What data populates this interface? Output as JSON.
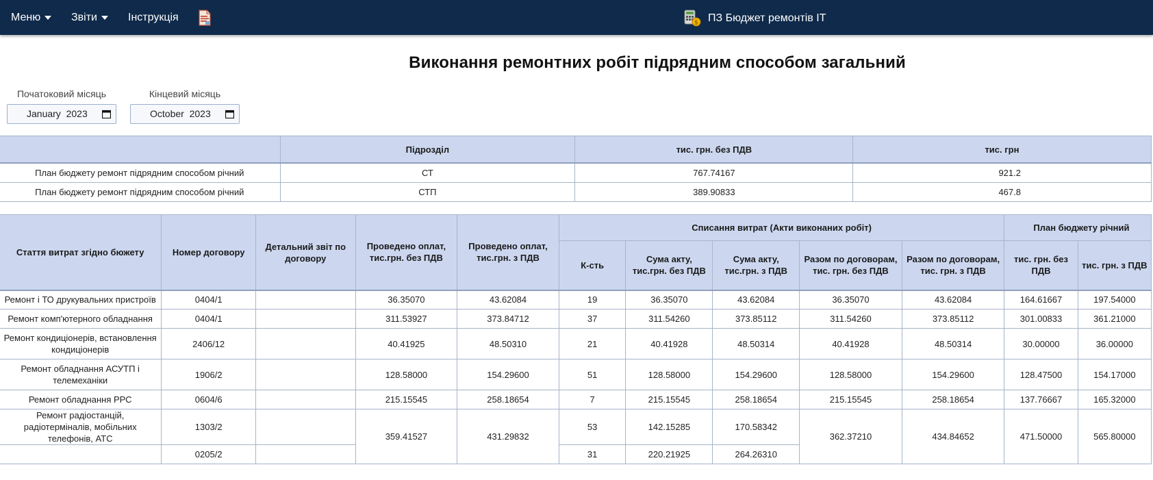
{
  "nav": {
    "menu_label": "Меню",
    "reports_label": "Звіти",
    "instructions_label": "Інструкція",
    "pdf_icon": "pdf-document-icon",
    "app_icon": "calculator-budget-icon",
    "app_title": "ПЗ Бюджет ремонтів ІТ",
    "colors": {
      "navbar_bg": "#0f2a4a",
      "header_bg": "#ccd7ef"
    }
  },
  "page_title": "Виконання ремонтних робіт підрядним способом загальний",
  "filters": {
    "start_label": "Початоковий місяць",
    "start_value": "January  2023",
    "end_label": "Кінцевий місяць",
    "end_value": "October  2023"
  },
  "summary_table": {
    "headers": [
      "",
      "Підрозділ",
      "тис. грн. без ПДВ",
      "тис. грн"
    ],
    "rows": [
      [
        "План бюджету ремонт підрядним способом річний",
        "СТ",
        "767.74167",
        "921.2"
      ],
      [
        "План бюджету ремонт підрядним способом річний",
        "СТП",
        "389.90833",
        "467.8"
      ]
    ]
  },
  "main_table": {
    "headers": {
      "article": "Стаття витрат згідно бюжету",
      "contract_no": "Номер договору",
      "detail_report": "Детальний звіт по договору",
      "paid_no_vat": "Проведено оплат, тис.грн. без ПДВ",
      "paid_vat": "Проведено оплат, тис.грн. з ПДВ",
      "writeoff_group": "Списання витрат (Акти виконаних робіт)",
      "count": "К-сть",
      "act_no_vat": "Сума акту, тис.грн. без ПДВ",
      "act_vat": "Сума акту, тис.грн. з ПДВ",
      "total_no_vat": "Разом по договорам, тис. грн. без ПДВ",
      "total_vat": "Разом по договорам, тис. грн. з ПДВ",
      "plan_group": "План бюджету річний",
      "plan_no_vat": "тис. грн. без ПДВ",
      "plan_vat": "тис. грн. з ПДВ"
    },
    "rows": [
      {
        "article": "Ремонт і ТО друкувальних пристроїв",
        "contract": "0404/1",
        "detail": "",
        "paid_no_vat": "36.35070",
        "paid_vat": "43.62084",
        "count": "19",
        "act_no_vat": "36.35070",
        "act_vat": "43.62084",
        "total_no_vat": "36.35070",
        "total_vat": "43.62084",
        "plan_no_vat": "164.61667",
        "plan_vat": "197.54000"
      },
      {
        "article": "Ремонт комп'ютерного обладнання",
        "contract": "0404/1",
        "detail": "",
        "paid_no_vat": "311.53927",
        "paid_vat": "373.84712",
        "count": "37",
        "act_no_vat": "311.54260",
        "act_vat": "373.85112",
        "total_no_vat": "311.54260",
        "total_vat": "373.85112",
        "plan_no_vat": "301.00833",
        "plan_vat": "361.21000"
      },
      {
        "article": "Ремонт кондиціонерів, встановлення кондиціонерів",
        "contract": "2406/12",
        "detail": "",
        "paid_no_vat": "40.41925",
        "paid_vat": "48.50310",
        "count": "21",
        "act_no_vat": "40.41928",
        "act_vat": "48.50314",
        "total_no_vat": "40.41928",
        "total_vat": "48.50314",
        "plan_no_vat": "30.00000",
        "plan_vat": "36.00000"
      },
      {
        "article": "Ремонт обладнання АСУТП і телемеханіки",
        "contract": "1906/2",
        "detail": "",
        "paid_no_vat": "128.58000",
        "paid_vat": "154.29600",
        "count": "51",
        "act_no_vat": "128.58000",
        "act_vat": "154.29600",
        "total_no_vat": "128.58000",
        "total_vat": "154.29600",
        "plan_no_vat": "128.47500",
        "plan_vat": "154.17000"
      },
      {
        "article": "Ремонт обладнання РРС",
        "contract": "0604/6",
        "detail": "",
        "paid_no_vat": "215.15545",
        "paid_vat": "258.18654",
        "count": "7",
        "act_no_vat": "215.15545",
        "act_vat": "258.18654",
        "total_no_vat": "215.15545",
        "total_vat": "258.18654",
        "plan_no_vat": "137.76667",
        "plan_vat": "165.32000"
      }
    ],
    "merged_row": {
      "article": "Ремонт радіостанцій, радіотерміналів, мобільних телефонів, АТС",
      "paid_no_vat": "359.41527",
      "paid_vat": "431.29832",
      "total_no_vat": "362.37210",
      "total_vat": "434.84652",
      "plan_no_vat": "471.50000",
      "plan_vat": "565.80000",
      "contracts": [
        {
          "contract": "1303/2",
          "count": "53",
          "act_no_vat": "142.15285",
          "act_vat": "170.58342"
        },
        {
          "contract": "0205/2",
          "count": "31",
          "act_no_vat": "220.21925",
          "act_vat": "264.26310"
        }
      ]
    }
  }
}
